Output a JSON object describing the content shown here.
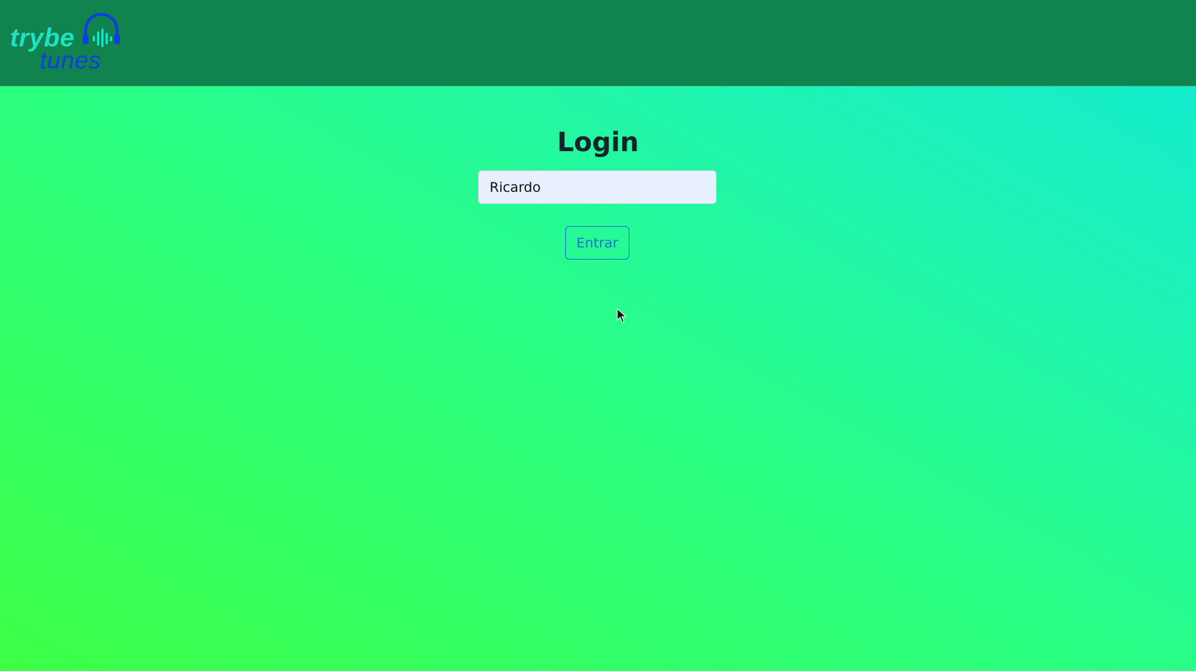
{
  "header": {
    "logo": {
      "word_top": "trybe",
      "word_bottom": "tunes",
      "icon": "headphones-icon",
      "colors": {
        "trybe": "#1ce3c4",
        "tunes": "#0f3fe0"
      }
    },
    "background_color": "#10834f"
  },
  "login": {
    "title": "Login",
    "name_input": {
      "value": "Ricardo",
      "placeholder": ""
    },
    "submit_label": "Entrar"
  },
  "colors": {
    "page_gradient": [
      "#3cff45",
      "#10ead6"
    ],
    "button_accent": "#1a6ed6",
    "title_text": "#152429"
  }
}
